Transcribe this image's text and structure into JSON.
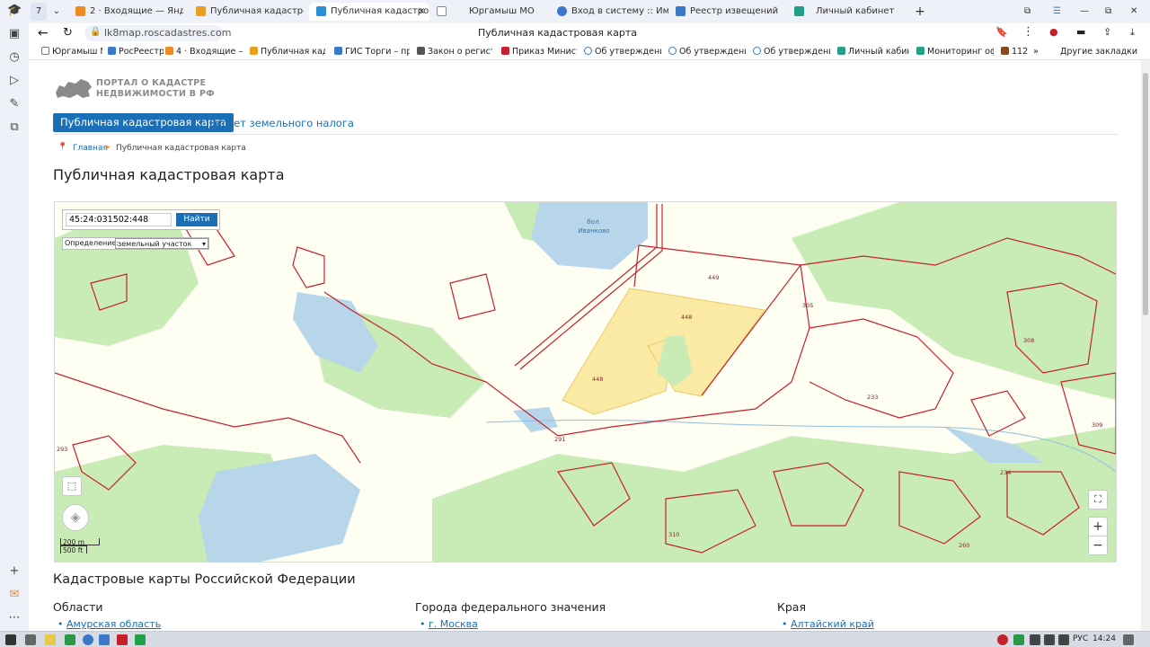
{
  "browser": {
    "tab_counter": "7",
    "tabs": [
      {
        "label": "2 · Входящие — Яндекс.П",
        "color": "#f08a24"
      },
      {
        "label": "Публичная кадастровая к",
        "color": "#e8a020"
      },
      {
        "label": "Публичная кадастровая",
        "color": "#2b8fd6"
      },
      {
        "label": "Юргамыш МО",
        "color": "#888888"
      },
      {
        "label": "Вход в систему :: Имущес",
        "color": "#3a78c8"
      },
      {
        "label": "Реестр извещений",
        "color": "#3a78c8"
      },
      {
        "label": "Личный кабинет",
        "color": "#21a087"
      }
    ],
    "new_tab": "+",
    "address_domain": "lk8map.roscadastres.com",
    "page_title": "Публичная кадастровая карта",
    "bookmarks": [
      "Юргамыш МО",
      "РосРеестр",
      "4 · Входящие — Я",
      "Публичная кадас",
      "ГИС Торги – прод",
      "Закон о регистра",
      "Приказ Министер",
      "Об утверждении",
      "Об утверждении",
      "Об утверждении",
      "Личный кабинет",
      "Мониторинг офо",
      "112"
    ],
    "other_bookmarks": "Другие закладки"
  },
  "site": {
    "logo_line1": "ПОРТАЛ О КАДАСТРЕ",
    "logo_line2": "НЕДВИЖИМОСТИ В РФ",
    "nav_primary": "Публичная кадастровая карта",
    "nav_secondary": "Расчет земельного налога",
    "breadcrumb_home": "Главная",
    "breadcrumb_current": "Публичная кадастровая карта",
    "heading": "Публичная кадастровая карта"
  },
  "map": {
    "search_value": "45:24:031502:448",
    "search_button": "Найти",
    "definition_label": "Определение:",
    "definition_selected": "земельный участок",
    "lake_label_1": "бол.",
    "lake_label_2": "Иванково",
    "parcel_labels": [
      "449",
      "448",
      "448",
      "305",
      "308",
      "233",
      "309",
      "234",
      "293",
      "291",
      "310",
      "260"
    ],
    "scale_top": "200 m",
    "scale_bottom": "500 ft",
    "zoom_in": "+",
    "zoom_out": "−",
    "colors": {
      "parcel_outline": "#c8202a",
      "selected_fill": "#fbe9a0",
      "forest": "#c9ecb6",
      "water": "#b8d6ea",
      "background": "#fefef3"
    }
  },
  "lower": {
    "section_title": "Кадастровые карты Российской Федерации",
    "col1_title": "Области",
    "col1_item": "Амурская область",
    "col2_title": "Города федерального значения",
    "col2_item": "г. Москва",
    "col3_title": "Края",
    "col3_item": "Алтайский край"
  },
  "taskbar": {
    "lang": "РУС",
    "time": "14:24"
  }
}
